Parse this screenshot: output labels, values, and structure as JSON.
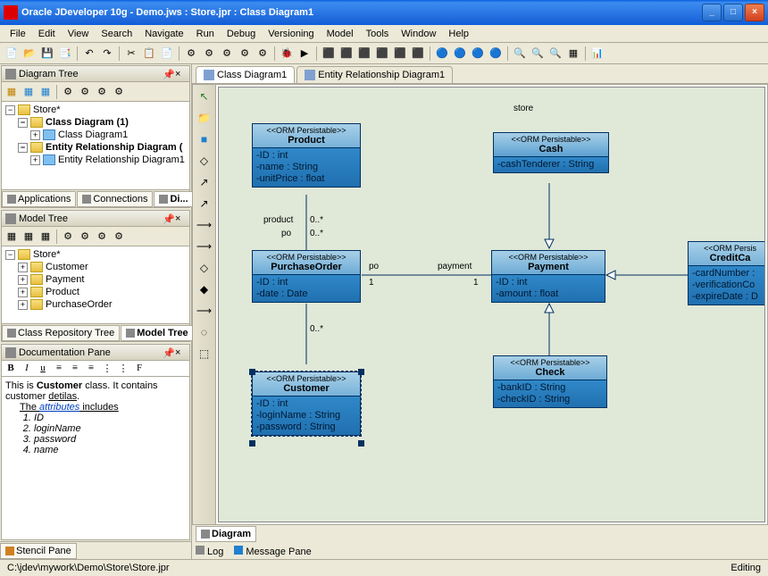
{
  "window": {
    "title": "Oracle JDeveloper 10g - Demo.jws : Store.jpr : Class Diagram1"
  },
  "menu": [
    "File",
    "Edit",
    "View",
    "Search",
    "Navigate",
    "Run",
    "Debug",
    "Versioning",
    "Model",
    "Tools",
    "Window",
    "Help"
  ],
  "panels": {
    "diagram_tree": {
      "title": "Diagram Tree",
      "root": "Store*",
      "items": [
        {
          "label": "Class Diagram (1)",
          "bold": true
        },
        {
          "label": "Class Diagram1",
          "child": true
        },
        {
          "label": "Entity Relationship Diagram (",
          "bold": true
        },
        {
          "label": "Entity Relationship Diagram1",
          "child": true
        }
      ],
      "tabs": [
        "Applications",
        "Connections",
        "Di..."
      ]
    },
    "model_tree": {
      "title": "Model Tree",
      "root": "Store*",
      "items": [
        "Customer",
        "Payment",
        "Product",
        "PurchaseOrder"
      ],
      "tabs": [
        "Class Repository Tree",
        "Model Tree"
      ]
    },
    "documentation": {
      "title": "Documentation Pane",
      "text1": "This is ",
      "bold1": "Customer",
      "text2": " class. It contains customer ",
      "under1": "detilas",
      "text3": ".",
      "text4": "The ",
      "attr": "attributes",
      "text5": " includes",
      "list": [
        "ID",
        "loginName",
        "password",
        "name"
      ]
    },
    "stencil": "Stencil Pane"
  },
  "editor": {
    "tabs": [
      "Class Diagram1",
      "Entity Relationship Diagram1"
    ],
    "package": "store",
    "bottom_tab": "Diagram",
    "log": "Log",
    "message": "Message Pane"
  },
  "classes": {
    "product": {
      "name": "Product",
      "stereo": "<<ORM Persistable>>",
      "attrs": [
        "-ID : int",
        "-name : String",
        "-unitPrice : float"
      ]
    },
    "cash": {
      "name": "Cash",
      "stereo": "<<ORM Persistable>>",
      "attrs": [
        "-cashTenderer : String"
      ]
    },
    "po": {
      "name": "PurchaseOrder",
      "stereo": "<<ORM Persistable>>",
      "attrs": [
        "-ID : int",
        "-date : Date"
      ]
    },
    "payment": {
      "name": "Payment",
      "stereo": "<<ORM Persistable>>",
      "attrs": [
        "-ID : int",
        "-amount : float"
      ]
    },
    "customer": {
      "name": "Customer",
      "stereo": "<<ORM Persistable>>",
      "attrs": [
        "-ID : int",
        "-loginName : String",
        "-password : String"
      ]
    },
    "check": {
      "name": "Check",
      "stereo": "<<ORM Persistable>>",
      "attrs": [
        "-bankID : String",
        "-checkID : String"
      ]
    },
    "cc": {
      "name": "CreditCa",
      "stereo": "<<ORM Persis",
      "attrs": [
        "-cardNumber : ",
        "-verificationCo",
        "-expireDate : D"
      ]
    }
  },
  "labels": {
    "product": "product",
    "po": "po",
    "zerostar": "0..*",
    "one": "1",
    "payment": "payment"
  },
  "status": {
    "path": "C:\\jdev\\mywork\\Demo\\Store\\Store.jpr",
    "mode": "Editing"
  }
}
